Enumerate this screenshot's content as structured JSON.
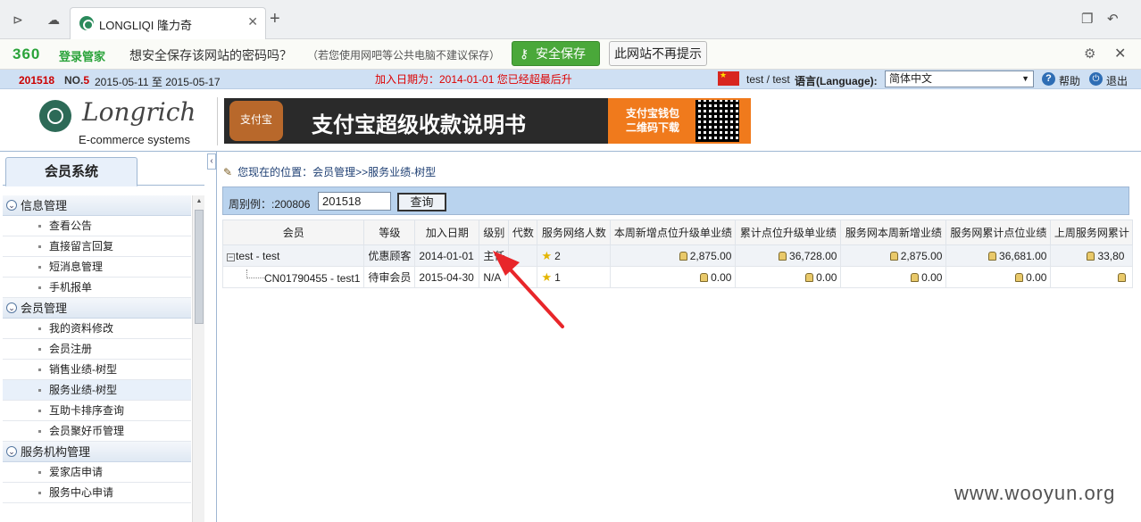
{
  "browser": {
    "tab_title": "LONGLIQI 隆力奇",
    "icons": [
      "forward-icon",
      "cloud-icon",
      "close-icon",
      "new-tab-icon",
      "restore-window-icon",
      "undo-icon"
    ]
  },
  "password_bar": {
    "brand": "360",
    "brand_name": "登录管家",
    "question": "想安全保存该网站的密码吗？",
    "note": "（若您使用网吧等公共电脑不建议保存）",
    "save_label": "安全保存",
    "never_label": "此网站不再提示"
  },
  "site_strip": {
    "week": "201518",
    "no_prefix": "NO.",
    "no_value": "5",
    "date_from": "2015-05-11",
    "date_to_word": "至",
    "date_to": "2015-05-17",
    "join_notice": "加入日期为：2014-01-01 您已经超最后升",
    "user": "test / test",
    "lang_label": "语言(Language):",
    "lang_value": "简体中文",
    "help": "帮助",
    "exit": "退出"
  },
  "header": {
    "logo_word": "Longrich",
    "logo_sub": "E-commerce systems",
    "banner_title": "支付宝超级收款说明书",
    "banner_sub_line1": "支付宝钱包",
    "banner_sub_line2": "二维码下载",
    "banner_wallet_text": "支付宝"
  },
  "sidebar": {
    "tab": "会员系统",
    "groups": [
      {
        "label": "信息管理",
        "items": [
          "查看公告",
          "直接留言回复",
          "短消息管理",
          "手机报单"
        ]
      },
      {
        "label": "会员管理",
        "items": [
          "我的资料修改",
          "会员注册",
          "销售业绩-树型",
          "服务业绩-树型",
          "互助卡排序查询",
          "会员聚好币管理"
        ]
      },
      {
        "label": "服务机构管理",
        "items": [
          "爱家店申请",
          "服务中心申请"
        ]
      }
    ]
  },
  "main": {
    "breadcrumb": "您现在的位置：会员管理>>服务业绩-树型",
    "query_label": "周别例：:200806",
    "query_value": "201518",
    "query_button": "查询",
    "columns": [
      "会员",
      "等级",
      "加入日期",
      "级别",
      "代数",
      "服务网络人数",
      "本周新增点位升级单业绩",
      "累计点位升级单业绩",
      "服务网本周新增业绩",
      "服务网累计点位业绩",
      "上周服务网累计"
    ],
    "rows": [
      {
        "member": "test - test",
        "grade": "优惠顾客",
        "join": "2014-01-01",
        "level": "主任",
        "gen": "",
        "net": "2",
        "c1": "2,875.00",
        "c2": "36,728.00",
        "c3": "2,875.00",
        "c4": "36,681.00",
        "c5": "33,80"
      },
      {
        "member": "CN01790455 - test1",
        "grade": "待审会员",
        "join": "2015-04-30",
        "level": "N/A",
        "gen": "",
        "net": "1",
        "c1": "0.00",
        "c2": "0.00",
        "c3": "0.00",
        "c4": "0.00",
        "c5": ""
      }
    ]
  },
  "watermark": "www.wooyun.org",
  "colors": {
    "accent_green": "#4aa83a",
    "strip_blue": "#cfe0f3",
    "arrow_red": "#e8262a"
  }
}
